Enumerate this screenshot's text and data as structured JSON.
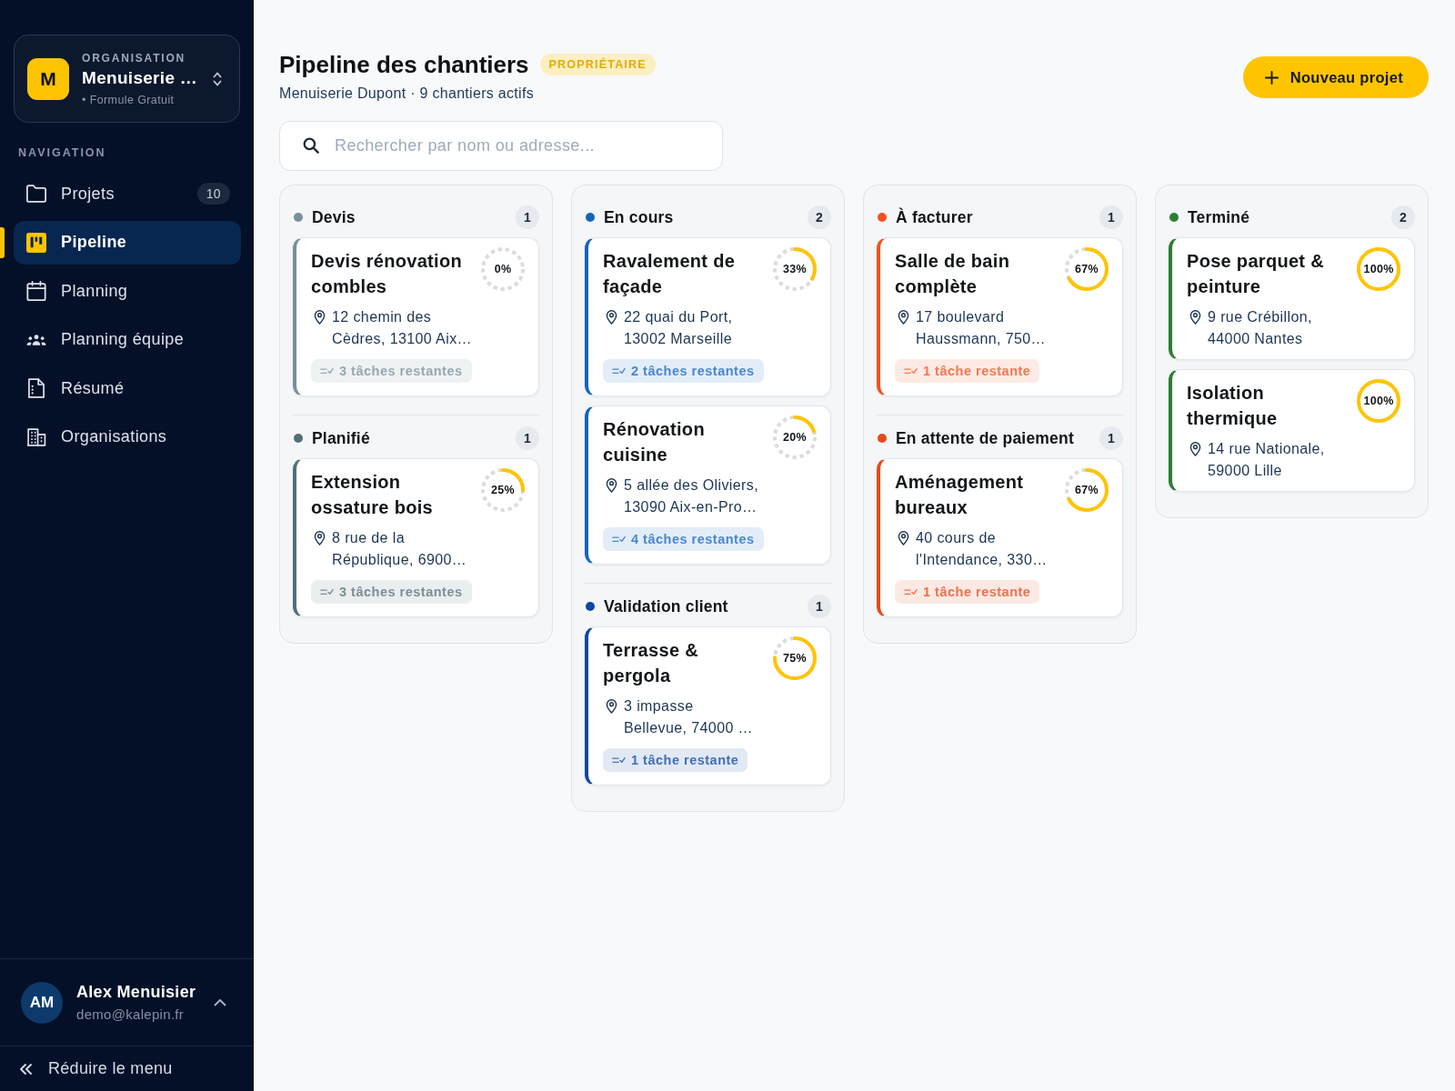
{
  "sidebar": {
    "organization": {
      "label": "ORGANISATION",
      "initial": "M",
      "name": "Menuiserie …",
      "plan": "• Formule Gratuit"
    },
    "nav_label": "NAVIGATION",
    "items": [
      {
        "label": "Projets",
        "badge": "10",
        "selected": false
      },
      {
        "label": "Pipeline",
        "selected": true
      },
      {
        "label": "Planning",
        "selected": false
      },
      {
        "label": "Planning équipe",
        "selected": false
      },
      {
        "label": "Résumé",
        "selected": false
      },
      {
        "label": "Organisations",
        "selected": false
      }
    ],
    "user": {
      "initials": "AM",
      "name": "Alex Menuisier",
      "email": "demo@kalepin.fr"
    },
    "collapse": "Réduire le menu"
  },
  "header": {
    "title": "Pipeline des chantiers",
    "role": "PROPRIÉTAIRE",
    "subtitle": "Menuiserie Dupont · 9 chantiers actifs",
    "new_button": "Nouveau projet"
  },
  "search": {
    "placeholder": "Rechercher par nom ou adresse..."
  },
  "board": {
    "columns": [
      {
        "groups": [
          {
            "name": "Devis",
            "color": "#78909c",
            "count": "1",
            "projects": [
              {
                "title": "Devis rénovation combles",
                "address": [
                  "12 chemin des",
                  "Cèdres, 13100 Aix…"
                ],
                "percent": "0%",
                "level": 0,
                "tasks": "3 tâches restantes"
              }
            ]
          },
          {
            "name": "Planifié",
            "color": "#546e7a",
            "count": "1",
            "projects": [
              {
                "title": "Extension ossature bois",
                "address": [
                  "8 rue de la",
                  "République, 6900…"
                ],
                "percent": "25%",
                "level": 0.25,
                "tasks": "3 tâches restantes"
              }
            ]
          }
        ]
      },
      {
        "groups": [
          {
            "name": "En cours",
            "color": "#1565c0",
            "count": "2",
            "projects": [
              {
                "title": "Ravalement de façade",
                "address": [
                  "22 quai du Port,",
                  "13002 Marseille"
                ],
                "percent": "33%",
                "level": 0.33,
                "tasks": "2 tâches restantes"
              },
              {
                "title": "Rénovation cuisine",
                "address": [
                  "5 allée des Oliviers,",
                  "13090 Aix-en-Pro…"
                ],
                "percent": "20%",
                "level": 0.2,
                "tasks": "4 tâches restantes"
              }
            ]
          },
          {
            "name": "Validation client",
            "color": "#0d47a1",
            "count": "1",
            "projects": [
              {
                "title": "Terrasse & pergola",
                "address": [
                  "3 impasse",
                  "Bellevue, 74000 …"
                ],
                "percent": "75%",
                "level": 0.75,
                "tasks": "1 tâche restante"
              }
            ]
          }
        ]
      },
      {
        "groups": [
          {
            "name": "À facturer",
            "color": "#f4511e",
            "count": "1",
            "projects": [
              {
                "title": "Salle de bain complète",
                "address": [
                  "17 boulevard",
                  "Haussmann, 750…"
                ],
                "percent": "67%",
                "level": 0.67,
                "tasks": "1 tâche restante"
              }
            ]
          },
          {
            "name": "En attente de paiement",
            "color": "#e64a19",
            "count": "1",
            "projects": [
              {
                "title": "Aménagement bureaux",
                "address": [
                  "40 cours de",
                  "l'Intendance, 330…"
                ],
                "percent": "67%",
                "level": 0.67,
                "tasks": "1 tâche restante"
              }
            ]
          }
        ]
      },
      {
        "groups": [
          {
            "name": "Terminé",
            "color": "#2e7d32",
            "count": "2",
            "projects": [
              {
                "title": "Pose parquet & peinture",
                "address": [
                  "9 rue Crébillon,",
                  "44000 Nantes"
                ],
                "percent": "100%",
                "level": 1
              },
              {
                "title": "Isolation thermique",
                "address": [
                  "14 rue Nationale,",
                  "59000 Lille"
                ],
                "percent": "100%",
                "level": 1
              }
            ]
          }
        ]
      }
    ]
  }
}
